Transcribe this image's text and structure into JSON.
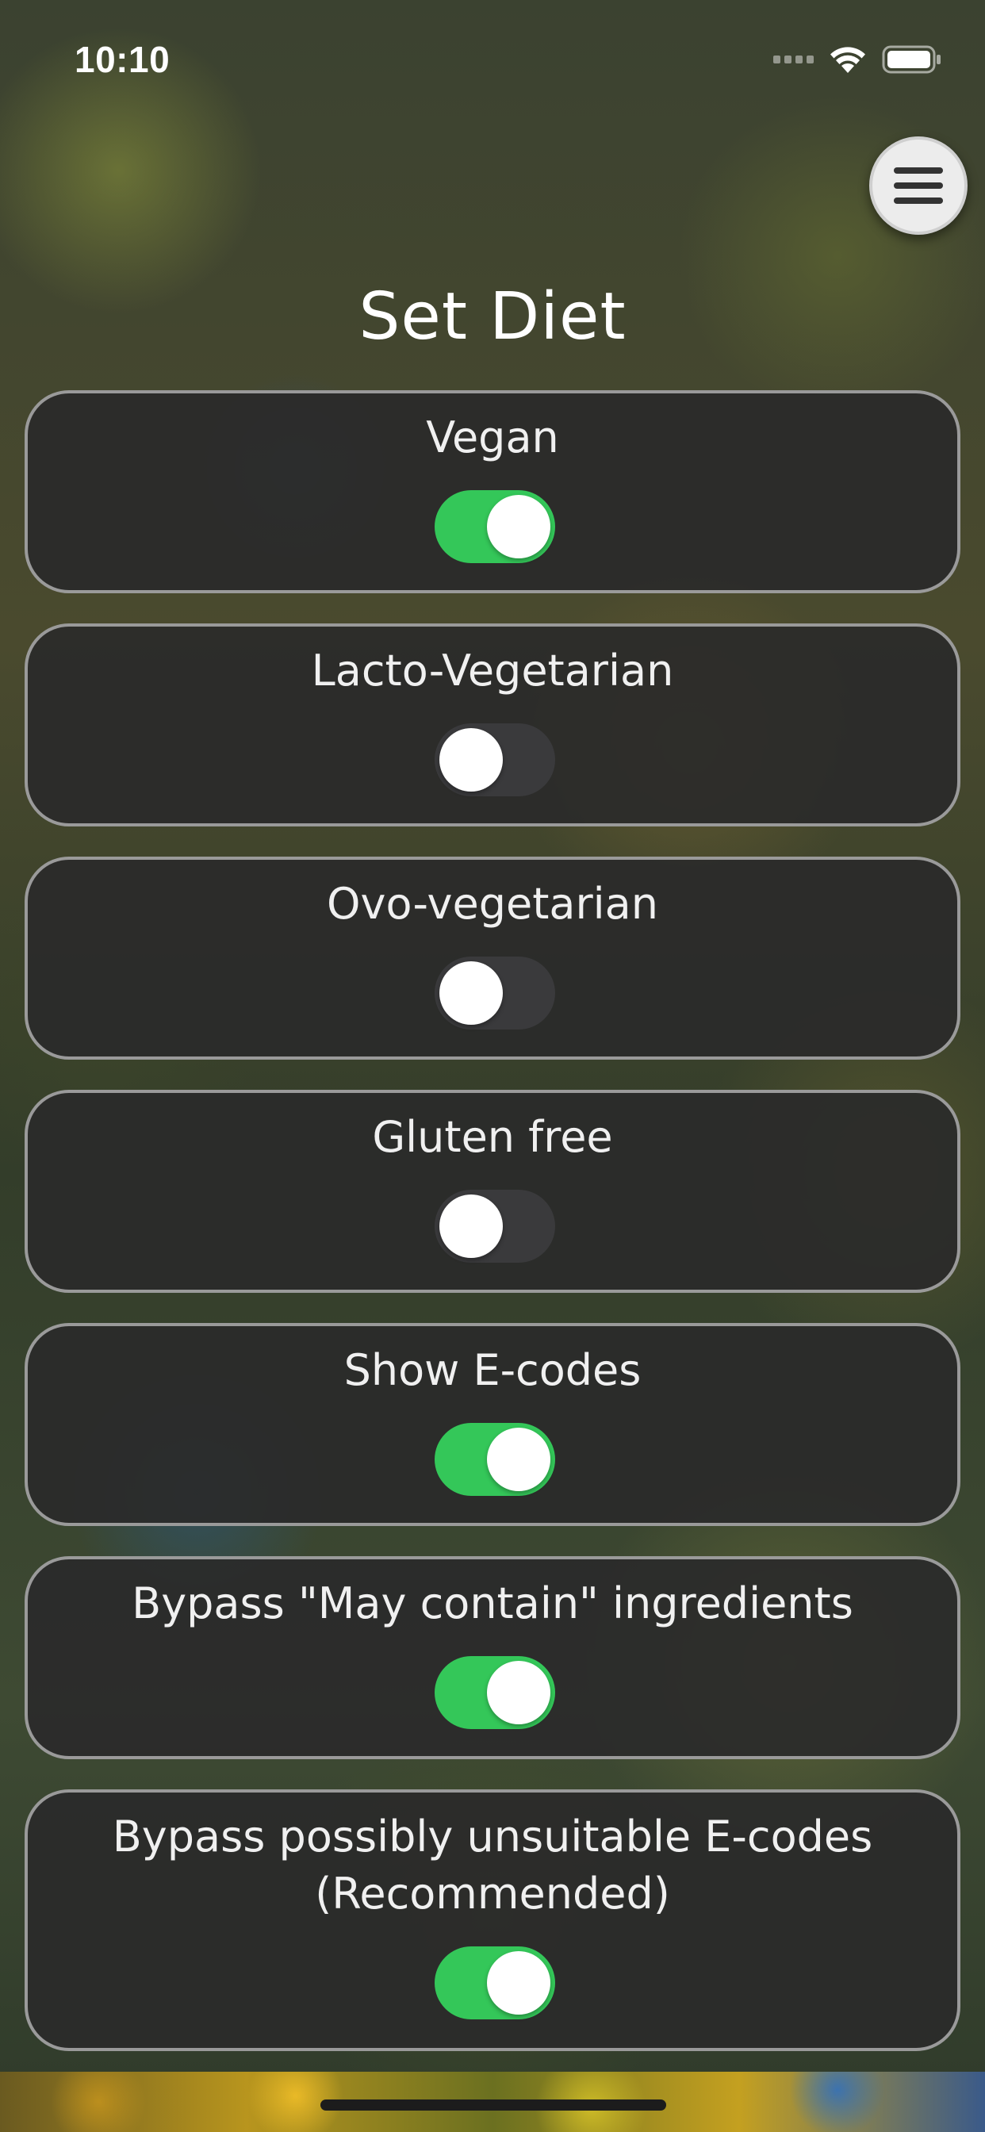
{
  "status_bar": {
    "time": "10:10",
    "icons": [
      "cellular-signal-icon",
      "wifi-icon",
      "battery-icon"
    ]
  },
  "header": {
    "title": "Set Diet",
    "menu_icon": "hamburger-menu-icon"
  },
  "colors": {
    "toggle_on": "#34c759",
    "toggle_off": "#3a3a3c",
    "card_background": "#2a2a2a",
    "card_border": "#9a9a9a",
    "menu_button": "#ececec"
  },
  "settings": [
    {
      "label": "Vegan",
      "enabled": true
    },
    {
      "label": "Lacto-Vegetarian",
      "enabled": false
    },
    {
      "label": "Ovo-vegetarian",
      "enabled": false
    },
    {
      "label": "Gluten free",
      "enabled": false
    },
    {
      "label": "Show E-codes",
      "enabled": true
    },
    {
      "label": "Bypass \"May contain\" ingredients",
      "enabled": true
    },
    {
      "label": "Bypass possibly unsuitable E-codes (Recommended)",
      "enabled": true
    }
  ]
}
